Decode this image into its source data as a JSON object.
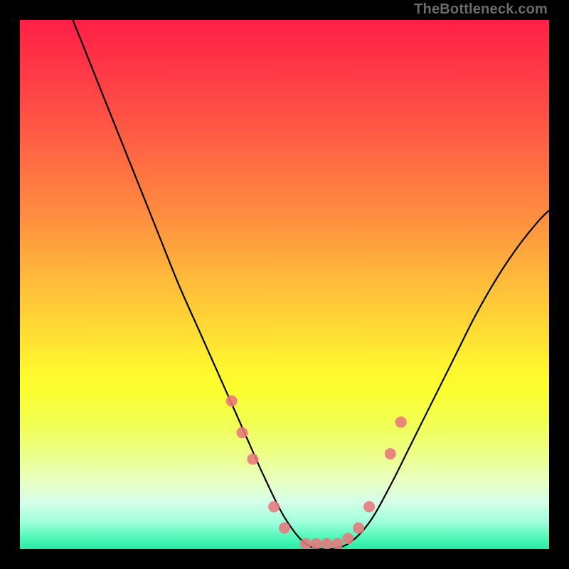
{
  "watermark": {
    "text": "TheBottleneck.com"
  },
  "chart_data": {
    "type": "line",
    "title": "",
    "xlabel": "",
    "ylabel": "",
    "xlim": [
      0,
      100
    ],
    "ylim": [
      0,
      100
    ],
    "series": [
      {
        "name": "bottleneck-curve",
        "x": [
          10,
          14,
          18,
          22,
          26,
          30,
          34,
          38,
          42,
          46,
          50,
          54,
          58,
          62,
          66,
          70,
          74,
          78,
          82,
          86,
          90,
          94,
          98,
          100
        ],
        "y": [
          100,
          90,
          80,
          70,
          60,
          50,
          41,
          32,
          23,
          14,
          6,
          1,
          0,
          1,
          5,
          12,
          20,
          28,
          36,
          44,
          51,
          57,
          62,
          64
        ]
      }
    ],
    "markers": {
      "name": "highlight-dots",
      "x": [
        40,
        42,
        44,
        48,
        50,
        54,
        56,
        58,
        60,
        62,
        64,
        66,
        70,
        72
      ],
      "y": [
        28,
        22,
        17,
        8,
        4,
        1,
        1,
        1,
        1,
        2,
        4,
        8,
        18,
        24
      ]
    },
    "colors": {
      "curve": "#000000",
      "marker": "#e9767b",
      "gradient_top": "#ff1f46",
      "gradient_mid": "#fff62f",
      "gradient_bottom": "#2ce9a4",
      "frame": "#000000"
    }
  }
}
